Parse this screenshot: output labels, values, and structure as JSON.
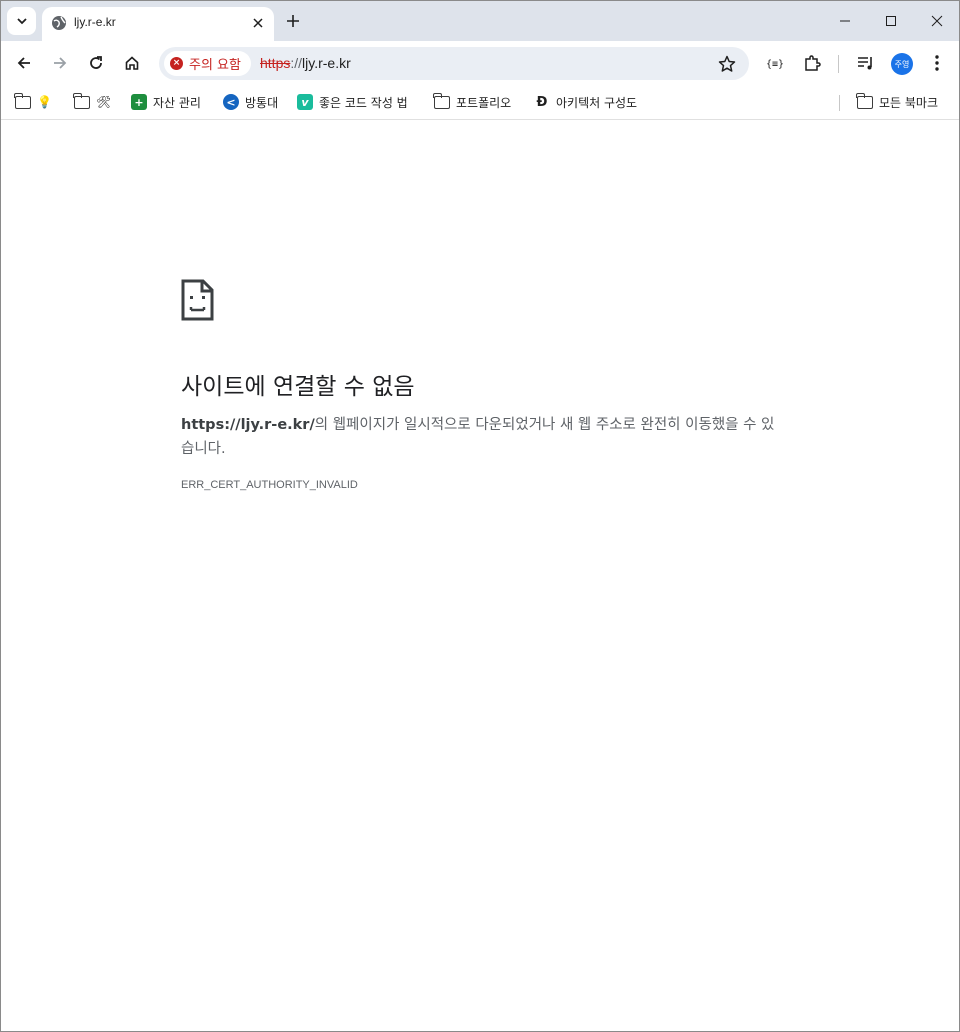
{
  "tab": {
    "title": "ljy.r-e.kr",
    "favicon": "globe-icon"
  },
  "omnibox": {
    "security_chip": "주의 요함",
    "url_scheme": "https",
    "url_separator": "://",
    "url_host": "ljy.r-e.kr"
  },
  "profile": {
    "initials": "주영"
  },
  "bookmarks": {
    "items": [
      {
        "label": "💡",
        "icon": "folder-icon"
      },
      {
        "label": "🛠",
        "icon": "folder-icon"
      },
      {
        "label": "자산 관리",
        "icon": "sheets-icon"
      },
      {
        "label": "방통대",
        "icon": "knou-icon"
      },
      {
        "label": "좋은 코드 작성 법",
        "icon": "v-icon"
      },
      {
        "label": "포트폴리오",
        "icon": "folder-icon"
      },
      {
        "label": "아키텍처 구성도",
        "icon": "d-icon"
      }
    ],
    "all_bookmarks": "모든 북마크"
  },
  "error": {
    "title": "사이트에 연결할 수 없음",
    "url_bold": "https://ljy.r-e.kr/",
    "message": "의 웹페이지가 일시적으로 다운되었거나 새 웹 주소로 완전히 이동했을 수 있습니다.",
    "code": "ERR_CERT_AUTHORITY_INVALID"
  },
  "colors": {
    "tabstrip": "#dee3eb",
    "omnibox": "#eaeef4",
    "warning_red": "#c5221f",
    "profile_blue": "#1a73e8"
  }
}
